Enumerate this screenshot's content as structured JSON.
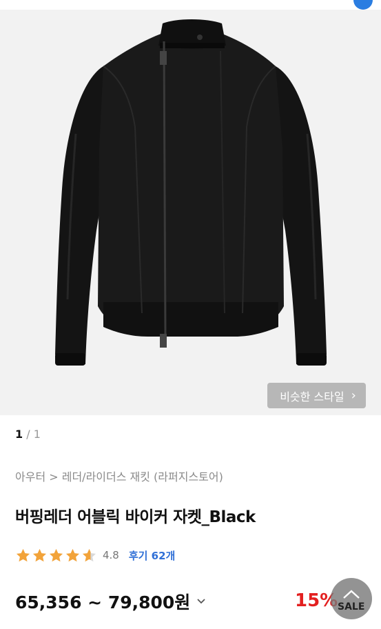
{
  "gallery": {
    "similar_style_label": "비슷한 스타일",
    "pager_current": "1",
    "pager_separator": " / ",
    "pager_total": "1",
    "image_subject": "black leather rider jacket"
  },
  "product": {
    "category_path": "아우터 > 레더/라이더스 재킷 (라퍼지스토어)",
    "title": "버핑레더 어블릭 바이커 자켓_Black",
    "rating_value": "4.8",
    "stars": 4.5,
    "review_link": "후기 62개",
    "price_range": "65,356 ~ 79,800원",
    "discount": "15%",
    "sale_label": "SALE"
  },
  "colors": {
    "star": "#f2a33a",
    "review_link": "#2f6fd6",
    "discount": "#e32020",
    "hero_bg": "#f2f2f2"
  },
  "icons": {
    "similar_chevron": "chevron-right-icon",
    "price_toggle": "chevron-down-icon",
    "scroll_top": "chevron-up-icon"
  }
}
